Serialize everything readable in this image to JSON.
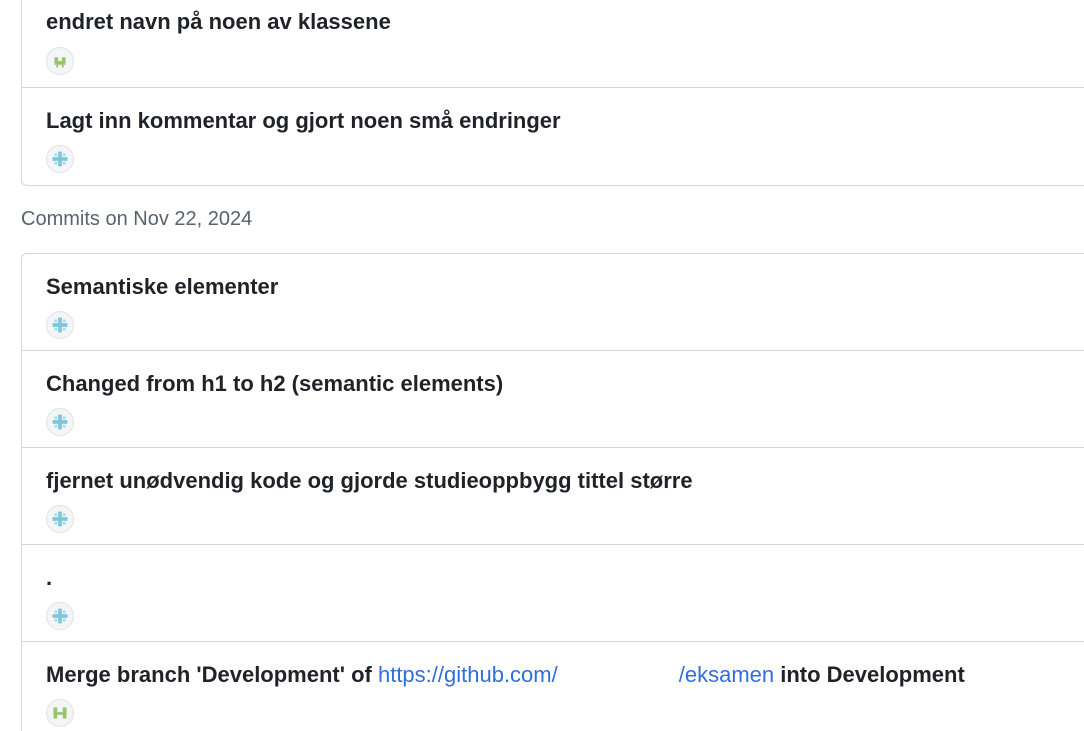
{
  "colors": {
    "link": "#2f6fdb",
    "border": "#d1d9e0",
    "avatar_green": "#9ac46c",
    "avatar_blue": "#7ec6db",
    "muted_text": "#59636e"
  },
  "groups": [
    {
      "date_label": "",
      "commits": [
        {
          "title": "endret navn på noen av klassene",
          "avatar_icon": "green-identicon-avatar"
        },
        {
          "title": "Lagt inn kommentar og gjort noen små endringer",
          "avatar_icon": "blue-identicon-avatar"
        }
      ]
    },
    {
      "date_label": "Commits on Nov 22, 2024",
      "commits": [
        {
          "title": "Semantiske elementer",
          "avatar_icon": "blue-identicon-avatar"
        },
        {
          "title": "Changed from h1 to h2 (semantic elements)",
          "avatar_icon": "blue-identicon-avatar"
        },
        {
          "title": "fjernet unødvendig kode og gjorde studieoppbygg tittel større",
          "avatar_icon": "blue-identicon-avatar"
        },
        {
          "title": ".",
          "avatar_icon": "blue-identicon-avatar"
        },
        {
          "title_prefix": "Merge branch 'Development' of ",
          "title_link_start": "https://github.com/",
          "title_link_end": "/eksamen",
          "title_suffix": " into Development",
          "avatar_icon": "green-identicon-avatar"
        }
      ]
    }
  ]
}
